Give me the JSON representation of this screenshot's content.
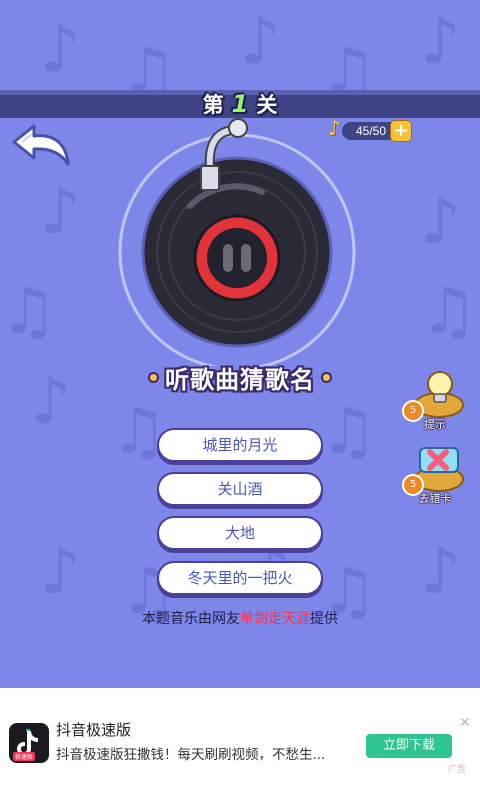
{
  "level": {
    "prefix": "第",
    "number": "1",
    "suffix": "关"
  },
  "coins": {
    "text": "45/50"
  },
  "quiz": {
    "title": "听歌曲猜歌名"
  },
  "options": [
    "城里的月光",
    "关山酒",
    "大地",
    "冬天里的一把火"
  ],
  "credit": {
    "before": "本题音乐由网友",
    "author": "单剑走天涯",
    "after": "提供"
  },
  "helpers": {
    "hint": {
      "label": "提示",
      "cost": "5"
    },
    "remove_wrong": {
      "label": "去错卡",
      "cost": "5"
    }
  },
  "ad": {
    "title": "抖音极速版",
    "description": "抖音极速版狂撒钱！每天刷刷视频，不愁生...",
    "cta": "立即下载",
    "label": "广告",
    "icon_label": "极速版"
  },
  "colors": {
    "background": "#7d87ea",
    "banner": "#3e4486",
    "accent_green": "#9df06a",
    "cta": "#2fc590",
    "highlight_red": "#ff2f4a"
  }
}
